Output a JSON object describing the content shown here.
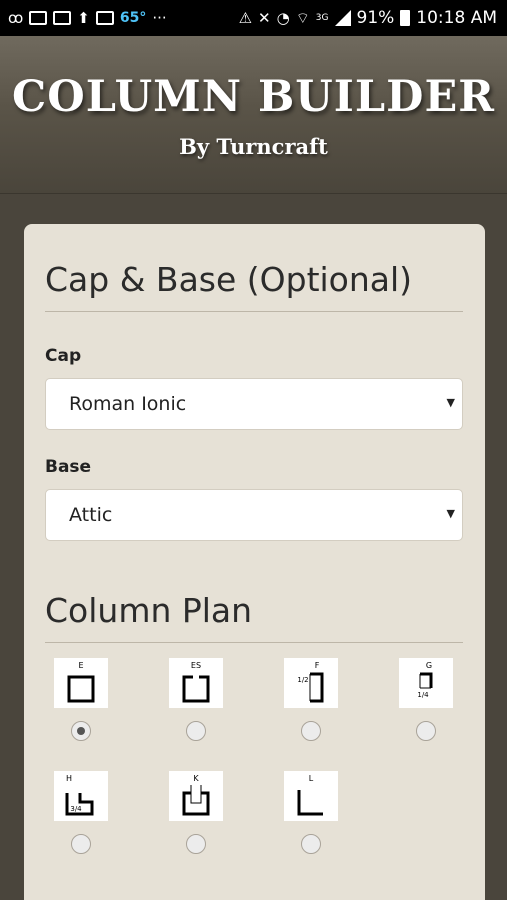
{
  "status_bar": {
    "temperature": "65°",
    "battery": "91%",
    "time": "10:18 AM",
    "network": "3G",
    "icons": [
      "voicemail-icon",
      "gmail-icon",
      "chat-icon",
      "upload-icon",
      "image-icon",
      "more-icon",
      "data-saver-icon",
      "mute-icon",
      "alarm-icon",
      "wifi-icon",
      "signal-icon",
      "battery-icon"
    ]
  },
  "header": {
    "title": "COLUMN BUILDER",
    "subtitle": "By Turncraft"
  },
  "cap_base": {
    "title": "Cap & Base (Optional)",
    "cap_label": "Cap",
    "cap_value": "Roman Ionic",
    "base_label": "Base",
    "base_value": "Attic"
  },
  "column_plan": {
    "title": "Column Plan",
    "options": [
      {
        "code": "E",
        "selected": true
      },
      {
        "code": "ES",
        "selected": false
      },
      {
        "code": "F",
        "note": "1/2",
        "selected": false
      },
      {
        "code": "G",
        "note": "1/4",
        "selected": false
      },
      {
        "code": "H",
        "note": "3/4",
        "selected": false
      },
      {
        "code": "K",
        "selected": false
      },
      {
        "code": "L",
        "selected": false
      }
    ]
  },
  "colors": {
    "background": "#4a453c",
    "card": "#e6e1d6",
    "header_top": "#706a5e"
  }
}
